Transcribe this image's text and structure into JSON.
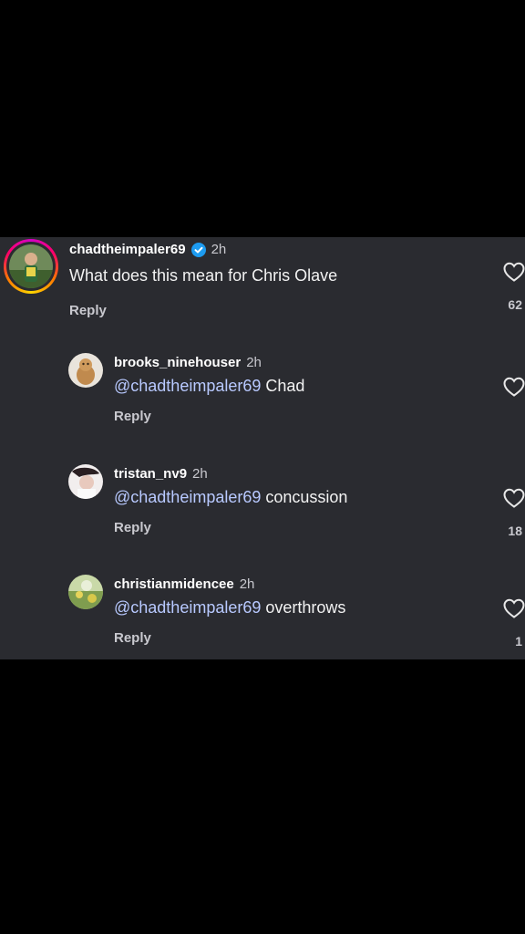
{
  "comments": [
    {
      "username": "chadtheimpaler69",
      "verified": true,
      "time": "2h",
      "mention": "",
      "text": "What does this mean for Chris Olave",
      "reply_label": "Reply",
      "likes": "62"
    },
    {
      "username": "brooks_ninehouser",
      "time": "2h",
      "mention": "@chadtheimpaler69",
      "text": " Chad",
      "reply_label": "Reply",
      "likes": ""
    },
    {
      "username": "tristan_nv9",
      "time": "2h",
      "mention": "@chadtheimpaler69",
      "text": " concussion",
      "reply_label": "Reply",
      "likes": "18"
    },
    {
      "username": "christianmidencee",
      "time": "2h",
      "mention": "@chadtheimpaler69",
      "text": " overthrows",
      "reply_label": "Reply",
      "likes": "1"
    }
  ],
  "colors": {
    "panel": "#2a2b30",
    "mention": "#b8c9ff",
    "verified": "#1d9bf0"
  }
}
